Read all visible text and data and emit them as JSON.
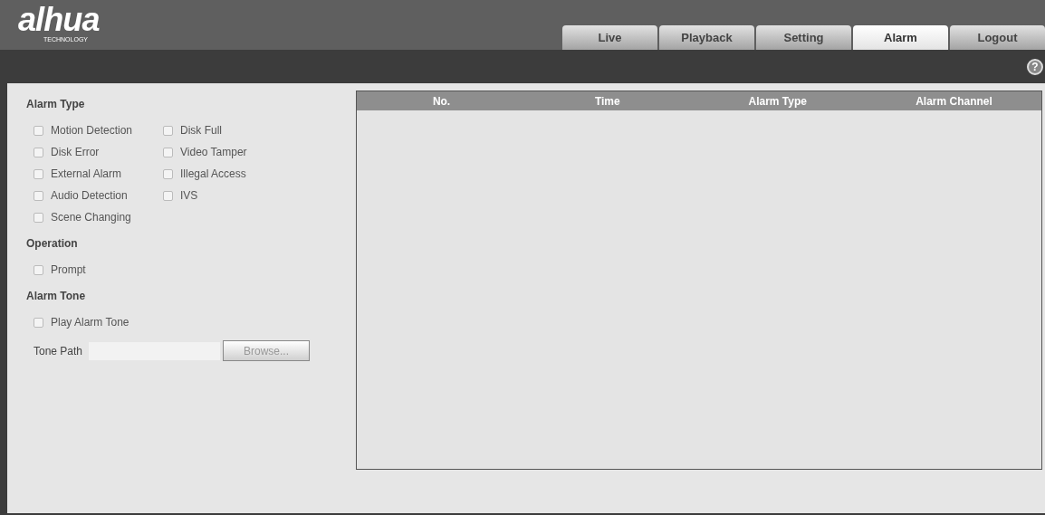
{
  "logo": {
    "text": "alhua",
    "subtitle": "TECHNOLOGY"
  },
  "tabs": [
    {
      "label": "Live",
      "selected": false
    },
    {
      "label": "Playback",
      "selected": false
    },
    {
      "label": "Setting",
      "selected": false
    },
    {
      "label": "Alarm",
      "selected": true
    },
    {
      "label": "Logout",
      "selected": false
    }
  ],
  "help": "?",
  "alarm_type": {
    "title": "Alarm Type",
    "options": [
      {
        "label": "Motion Detection",
        "checked": false
      },
      {
        "label": "Disk Full",
        "checked": false
      },
      {
        "label": "Disk Error",
        "checked": false
      },
      {
        "label": "Video Tamper",
        "checked": false
      },
      {
        "label": "External Alarm",
        "checked": false
      },
      {
        "label": "Illegal Access",
        "checked": false
      },
      {
        "label": "Audio Detection",
        "checked": false
      },
      {
        "label": "IVS",
        "checked": false
      },
      {
        "label": "Scene Changing",
        "checked": false
      }
    ]
  },
  "operation": {
    "title": "Operation",
    "options": [
      {
        "label": "Prompt",
        "checked": false
      }
    ]
  },
  "alarm_tone": {
    "title": "Alarm Tone",
    "options": [
      {
        "label": "Play Alarm Tone",
        "checked": false
      }
    ],
    "tone_path_label": "Tone Path",
    "browse_button": "Browse..."
  },
  "table": {
    "columns": [
      "No.",
      "Time",
      "Alarm Type",
      "Alarm Channel"
    ]
  }
}
